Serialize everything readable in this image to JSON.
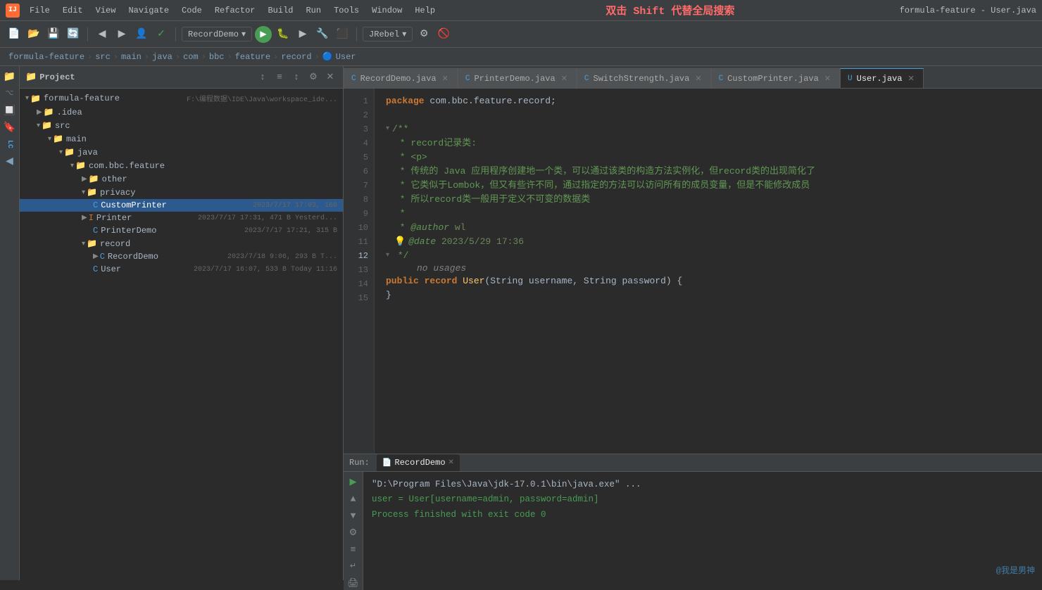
{
  "titleBar": {
    "logo": "IJ",
    "menuItems": [
      "File",
      "Edit",
      "View",
      "Navigate",
      "Code",
      "Refactor",
      "Build",
      "Run",
      "Tools",
      "Window",
      "Help"
    ],
    "centerText": "双击 Shift 代替全局搜索",
    "windowTitle": "formula-feature - User.java"
  },
  "toolbar": {
    "dropdownLabel": "RecordDemo",
    "jrebelLabel": "JRebel"
  },
  "breadcrumb": {
    "items": [
      "formula-feature",
      "src",
      "main",
      "java",
      "com",
      "bbc",
      "feature",
      "record",
      "User"
    ]
  },
  "projectPanel": {
    "title": "Project",
    "rootLabel": "formula-feature",
    "rootPath": "F:\\编程数据\\IDE\\Java\\workspace_ide...",
    "treeItems": [
      {
        "id": "idea",
        "label": ".idea",
        "indent": 1,
        "type": "folder",
        "collapsed": true
      },
      {
        "id": "src",
        "label": "src",
        "indent": 1,
        "type": "folder",
        "collapsed": false
      },
      {
        "id": "main",
        "label": "main",
        "indent": 2,
        "type": "folder",
        "collapsed": false
      },
      {
        "id": "java",
        "label": "java",
        "indent": 3,
        "type": "folder",
        "collapsed": false
      },
      {
        "id": "com.bbc.feature",
        "label": "com.bbc.feature",
        "indent": 4,
        "type": "package",
        "collapsed": false
      },
      {
        "id": "other",
        "label": "other",
        "indent": 5,
        "type": "folder",
        "collapsed": true
      },
      {
        "id": "privacy",
        "label": "privacy",
        "indent": 5,
        "type": "folder",
        "collapsed": false
      },
      {
        "id": "CustomPrinter",
        "label": "CustomPrinter",
        "indent": 6,
        "type": "class",
        "meta": "2023/7/17 17:03, 166",
        "active": true
      },
      {
        "id": "Printer",
        "label": "Printer",
        "indent": 6,
        "type": "interface",
        "meta": "2023/7/17 17:31, 471 B Yesterd..."
      },
      {
        "id": "PrinterDemo",
        "label": "PrinterDemo",
        "indent": 6,
        "type": "class",
        "meta": "2023/7/17 17:21, 315 B"
      },
      {
        "id": "record",
        "label": "record",
        "indent": 5,
        "type": "folder",
        "collapsed": false
      },
      {
        "id": "RecordDemo",
        "label": "RecordDemo",
        "indent": 6,
        "type": "class",
        "meta": "2023/7/18 9:06, 293 B T..."
      },
      {
        "id": "User",
        "label": "User",
        "indent": 6,
        "type": "class",
        "meta": "2023/7/17 16:07, 533 B Today 11:16"
      }
    ]
  },
  "tabs": [
    {
      "id": "RecordDemo",
      "label": "RecordDemo.java",
      "type": "class",
      "active": false
    },
    {
      "id": "PrinterDemo",
      "label": "PrinterDemo.java",
      "type": "class",
      "active": false
    },
    {
      "id": "SwitchStrength",
      "label": "SwitchStrength.java",
      "type": "class",
      "active": false
    },
    {
      "id": "CustomPrinter",
      "label": "CustomPrinter.java",
      "type": "class",
      "active": false
    },
    {
      "id": "User",
      "label": "User.java",
      "type": "class",
      "active": true
    }
  ],
  "codeLines": [
    {
      "num": 1,
      "content": "package_com.bbc.feature.record;"
    },
    {
      "num": 2,
      "content": ""
    },
    {
      "num": 3,
      "content": "/**",
      "fold": true
    },
    {
      "num": 4,
      "content": " * record记录类:"
    },
    {
      "num": 5,
      "content": " * <p>"
    },
    {
      "num": 6,
      "content": " * 传统的 Java 应用程序创建地一个类，可以通过该类的构造方法实例化，但record类的出现简化了..."
    },
    {
      "num": 7,
      "content": " * 它类似于Lombok，但又有些许不同，通过指定的方法可以访问所有的成员变量，但是不能修改成员..."
    },
    {
      "num": 8,
      "content": " * 所以record类一般用于定义不可变的数据类"
    },
    {
      "num": 9,
      "content": " *"
    },
    {
      "num": 10,
      "content": " * @author wl"
    },
    {
      "num": 11,
      "content": " * @date 2023/5/29 17:36"
    },
    {
      "num": 12,
      "content": " */",
      "fold": true
    },
    {
      "num": 13,
      "content": "public_record_User(String username, String password) {",
      "noUsages": true
    },
    {
      "num": 14,
      "content": "}"
    },
    {
      "num": 15,
      "content": ""
    }
  ],
  "bottomPanel": {
    "tabLabel": "RecordDemo",
    "runLabel": "Run:",
    "outputLines": [
      "\"D:\\Program Files\\Java\\jdk-17.0.1\\bin\\java.exe\" ...",
      "user = User[username=admin, password=admin]",
      "",
      "Process finished with exit code 0"
    ]
  },
  "watermark": "@我是男神"
}
